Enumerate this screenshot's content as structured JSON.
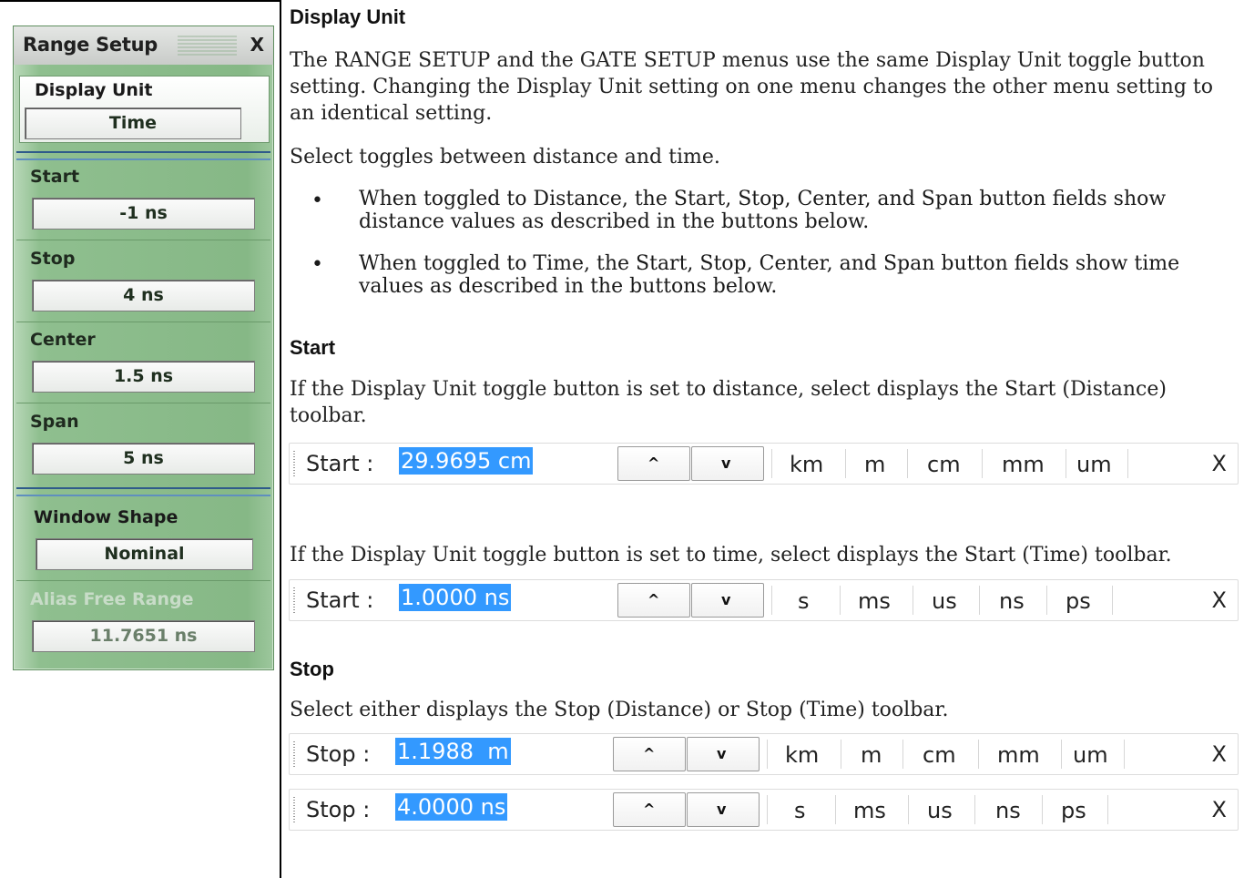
{
  "menu": {
    "title": "Range Setup",
    "close": "X",
    "display_unit": {
      "label": "Display Unit",
      "value": "Time"
    },
    "start": {
      "label": "Start",
      "value": "-1 ns"
    },
    "stop": {
      "label": "Stop",
      "value": "4 ns"
    },
    "center": {
      "label": "Center",
      "value": "1.5 ns"
    },
    "span": {
      "label": "Span",
      "value": "5 ns"
    },
    "window_shape": {
      "label": "Window Shape",
      "value": "Nominal"
    },
    "alias_free_range": {
      "label": "Alias Free Range",
      "value": "11.7651 ns"
    }
  },
  "doc": {
    "display_unit_heading": "Display Unit",
    "display_unit_para_1": "The RANGE SETUP and the GATE SETUP menus use the same Display Unit toggle button setting. Changing the Display Unit setting on one menu changes the other menu setting to an identical setting.",
    "display_unit_para_2": "Select toggles between distance and time.",
    "bullet_1_line_1": "When toggled to Distance, the Start, Stop, Center, and Span button fields show",
    "bullet_1_line_2": "distance values as described in the buttons below.",
    "bullet_2_line_1": "When toggled to Time, the Start, Stop, Center, and Span button fields show time",
    "bullet_2_line_2": "values as described in the buttons below.",
    "start_heading": "Start",
    "start_para_1_line_1": "If the Display Unit toggle button is set to distance, select displays the Start (Distance)",
    "start_para_1_line_2": "toolbar.",
    "start_para_2": "If the Display Unit toggle button is set to time, select displays the Start (Time) toolbar.",
    "stop_heading": "Stop",
    "stop_para": "Select either displays the Stop (Distance) or Stop (Time) toolbar."
  },
  "toolbars": {
    "start_distance": {
      "label": "Start  :",
      "value": "29.9695 cm",
      "units": [
        "km",
        "m",
        "cm",
        "mm",
        "um"
      ],
      "close": "X"
    },
    "start_time": {
      "label": "Start  :",
      "value": "1.0000 ns",
      "units": [
        "s",
        "ms",
        "us",
        "ns",
        "ps"
      ],
      "close": "X"
    },
    "stop_distance": {
      "label": "Stop  :",
      "value": "1.1988  m",
      "units": [
        "km",
        "m",
        "cm",
        "mm",
        "um"
      ],
      "close": "X"
    },
    "stop_time": {
      "label": "Stop  :",
      "value": "4.0000 ns",
      "units": [
        "s",
        "ms",
        "us",
        "ns",
        "ps"
      ],
      "close": "X"
    },
    "up_glyph": "^",
    "down_glyph": "v"
  }
}
